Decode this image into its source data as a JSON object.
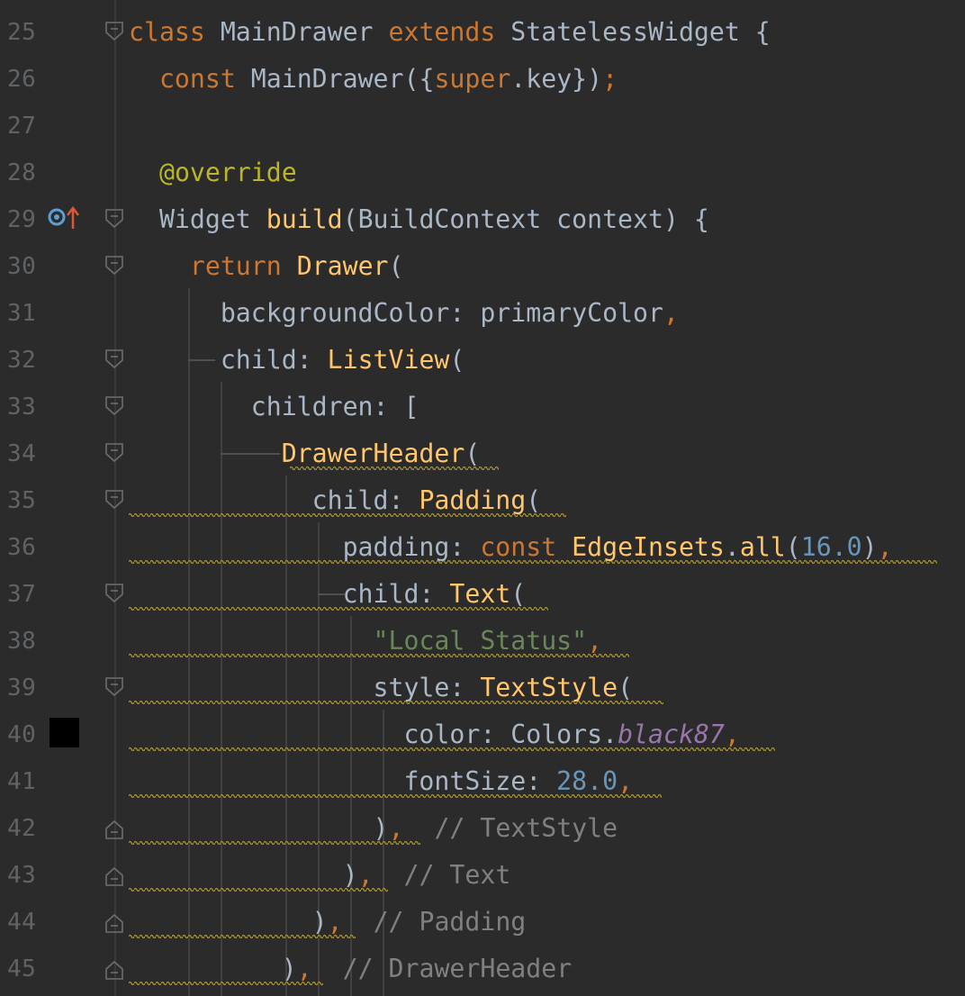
{
  "editor": {
    "lines": [
      {
        "num": "25",
        "fold": "open",
        "tokens": [
          {
            "t": "class",
            "c": "kw"
          },
          {
            "t": " MainDrawer "
          },
          {
            "t": "extends",
            "c": "kw"
          },
          {
            "t": " StatelessWidget {"
          }
        ]
      },
      {
        "num": "26",
        "fold": null,
        "tokens": [
          {
            "t": "  "
          },
          {
            "t": "const",
            "c": "kw"
          },
          {
            "t": " MainDrawer({"
          },
          {
            "t": "super",
            "c": "kw"
          },
          {
            "t": ".key})"
          },
          {
            "t": ";",
            "c": "kw"
          }
        ]
      },
      {
        "num": "27",
        "fold": null,
        "tokens": []
      },
      {
        "num": "28",
        "fold": null,
        "tokens": [
          {
            "t": "  "
          },
          {
            "t": "@",
            "c": "ann"
          },
          {
            "t": "override",
            "c": "ann"
          }
        ]
      },
      {
        "num": "29",
        "fold": "open",
        "tokens": [
          {
            "t": "  Widget "
          },
          {
            "t": "build",
            "c": "fn"
          },
          {
            "t": "(BuildContext context) {"
          }
        ]
      },
      {
        "num": "30",
        "fold": "open",
        "tokens": [
          {
            "t": "    "
          },
          {
            "t": "return",
            "c": "kw"
          },
          {
            "t": " "
          },
          {
            "t": "Drawer",
            "c": "fn"
          },
          {
            "t": "("
          }
        ]
      },
      {
        "num": "31",
        "fold": null,
        "tokens": [
          {
            "t": "      backgroundColor: primaryColor"
          },
          {
            "t": ",",
            "c": "kw"
          }
        ]
      },
      {
        "num": "32",
        "fold": "open",
        "tokens": [
          {
            "t": "      child: "
          },
          {
            "t": "ListView",
            "c": "fn"
          },
          {
            "t": "("
          }
        ]
      },
      {
        "num": "33",
        "fold": "open",
        "tokens": [
          {
            "t": "        children: ["
          }
        ]
      },
      {
        "num": "34",
        "fold": "open",
        "tokens": [
          {
            "t": "          "
          },
          {
            "t": "DrawerHeader",
            "c": "fn"
          },
          {
            "t": "("
          }
        ]
      },
      {
        "num": "35",
        "fold": "open",
        "tokens": [
          {
            "t": "            child: "
          },
          {
            "t": "Padding",
            "c": "fn"
          },
          {
            "t": "("
          }
        ]
      },
      {
        "num": "36",
        "fold": null,
        "tokens": [
          {
            "t": "              padding: "
          },
          {
            "t": "const",
            "c": "kw"
          },
          {
            "t": " "
          },
          {
            "t": "EdgeInsets",
            "c": "fn"
          },
          {
            "t": "."
          },
          {
            "t": "all",
            "c": "fn"
          },
          {
            "t": "("
          },
          {
            "t": "16.0",
            "c": "num"
          },
          {
            "t": ")"
          },
          {
            "t": ",",
            "c": "kw"
          }
        ]
      },
      {
        "num": "37",
        "fold": "open",
        "tokens": [
          {
            "t": "              child: "
          },
          {
            "t": "Text",
            "c": "fn"
          },
          {
            "t": "("
          }
        ]
      },
      {
        "num": "38",
        "fold": null,
        "tokens": [
          {
            "t": "                "
          },
          {
            "t": "\"Local Status\"",
            "c": "str"
          },
          {
            "t": ",",
            "c": "kw"
          }
        ]
      },
      {
        "num": "39",
        "fold": "open",
        "tokens": [
          {
            "t": "                style: "
          },
          {
            "t": "TextStyle",
            "c": "fn"
          },
          {
            "t": "("
          }
        ]
      },
      {
        "num": "40",
        "fold": null,
        "tokens": [
          {
            "t": "                  color: Colors."
          },
          {
            "t": "black87",
            "c": "it"
          },
          {
            "t": ",",
            "c": "kw"
          }
        ]
      },
      {
        "num": "41",
        "fold": null,
        "tokens": [
          {
            "t": "                  fontSize: "
          },
          {
            "t": "28.0",
            "c": "num"
          },
          {
            "t": ",",
            "c": "kw"
          }
        ]
      },
      {
        "num": "42",
        "fold": "close",
        "tokens": [
          {
            "t": "                )"
          },
          {
            "t": ",",
            "c": "kw"
          },
          {
            "t": "  "
          },
          {
            "t": "// TextStyle",
            "c": "cm"
          }
        ]
      },
      {
        "num": "43",
        "fold": "close",
        "tokens": [
          {
            "t": "              )"
          },
          {
            "t": ",",
            "c": "kw"
          },
          {
            "t": "  "
          },
          {
            "t": "// Text",
            "c": "cm"
          }
        ]
      },
      {
        "num": "44",
        "fold": "close",
        "tokens": [
          {
            "t": "            )"
          },
          {
            "t": ",",
            "c": "kw"
          },
          {
            "t": "  "
          },
          {
            "t": "// Padding",
            "c": "cm"
          }
        ]
      },
      {
        "num": "45",
        "fold": "close",
        "tokens": [
          {
            "t": "          )"
          },
          {
            "t": ",",
            "c": "kw"
          },
          {
            "t": "  "
          },
          {
            "t": "// DrawerHeader",
            "c": "cm"
          }
        ]
      }
    ],
    "gutter_icons": {
      "override_line": "29",
      "override_icon": "override-method-icon",
      "color_swatch_line": "40",
      "color_swatch_color": "#000000"
    },
    "colors": {
      "background": "#2b2b2b",
      "keyword": "#cc7832",
      "function": "#ffc66d",
      "number": "#6897bb",
      "string": "#6a8759",
      "comment": "#808080",
      "annotation": "#bbb529",
      "constant": "#9876aa",
      "text": "#a9b7c6",
      "line_number": "#606366"
    }
  }
}
